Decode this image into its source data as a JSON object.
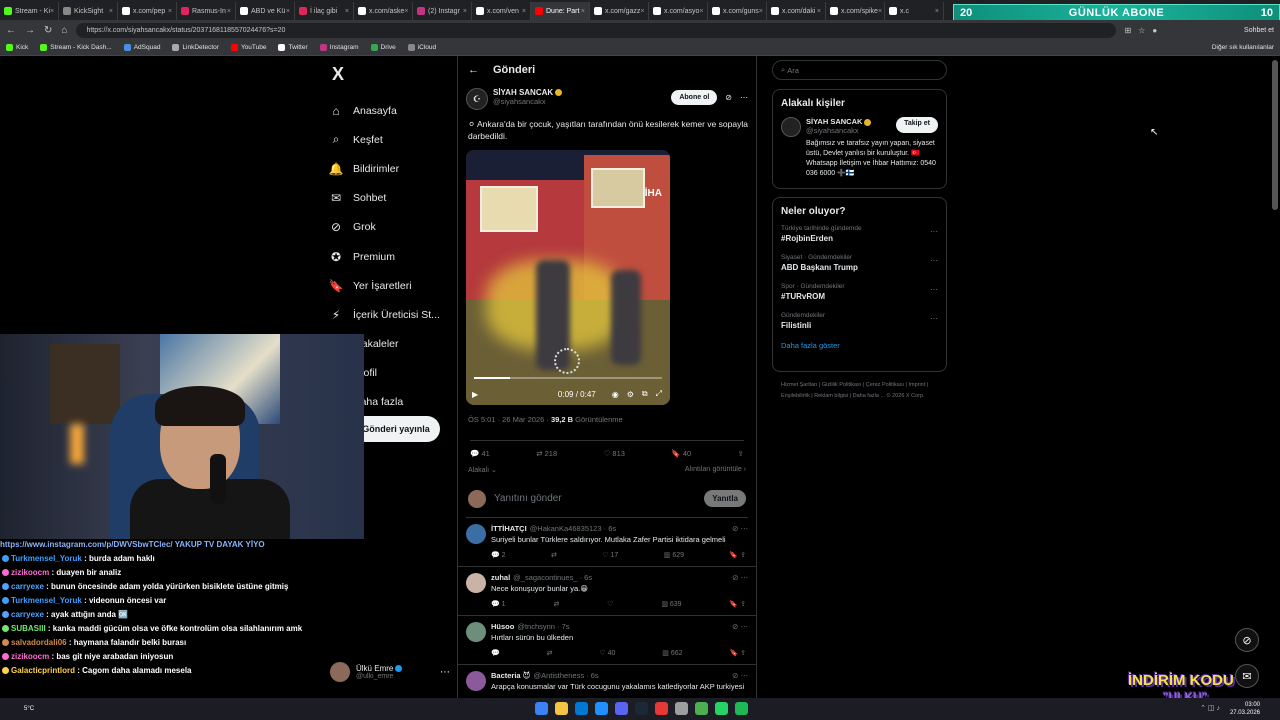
{
  "browser": {
    "tabs": [
      {
        "label": "Stream - Ki",
        "color": "#53fc18"
      },
      {
        "label": "KickSight",
        "color": "#888888"
      },
      {
        "label": "x.com/pep",
        "color": "#ffffff"
      },
      {
        "label": "Rasmus-In",
        "color": "#e0245e"
      },
      {
        "label": "ABD ve Kü",
        "color": "#ffffff"
      },
      {
        "label": "İ ilaç gibi",
        "color": "#e0245e"
      },
      {
        "label": "x.com/aske",
        "color": "#ffffff"
      },
      {
        "label": "(2) Instagr",
        "color": "#c13584"
      },
      {
        "label": "x.com/ven",
        "color": "#ffffff"
      },
      {
        "label": "Dune: Part",
        "color": "#ff0000"
      },
      {
        "label": "x.com/gazz",
        "color": "#ffffff"
      },
      {
        "label": "x.com/asyo",
        "color": "#ffffff"
      },
      {
        "label": "x.com/guns",
        "color": "#ffffff"
      },
      {
        "label": "x.com/daki",
        "color": "#ffffff"
      },
      {
        "label": "x.com/spike",
        "color": "#ffffff"
      },
      {
        "label": "x.c",
        "color": "#ffffff"
      }
    ],
    "url": "https://x.com/siyahsancakx/status/2037168118557024476?s=20",
    "chat_button": "Sohbet et",
    "bookmarks": [
      {
        "label": "Kick",
        "color": "#53fc18"
      },
      {
        "label": "Stream - Kick Dash...",
        "color": "#53fc18"
      },
      {
        "label": "AdSquad",
        "color": "#4a90e2"
      },
      {
        "label": "LinkDetector",
        "color": "#aaaaaa"
      },
      {
        "label": "YouTube",
        "color": "#ff0000"
      },
      {
        "label": "Twitter",
        "color": "#ffffff"
      },
      {
        "label": "Instagram",
        "color": "#c13584"
      },
      {
        "label": "Drive",
        "color": "#34a853"
      },
      {
        "label": "iCloud",
        "color": "#888888"
      }
    ],
    "other_bookmarks": "Diğer sık kullanılanlar"
  },
  "abone_banner": {
    "left": "20",
    "title": "GÜNLÜK ABONE",
    "right": "10"
  },
  "nav": {
    "logo": "X",
    "items": [
      {
        "label": "Anasayfa",
        "icon": "home-icon",
        "glyph": "⌂"
      },
      {
        "label": "Keşfet",
        "icon": "search-icon",
        "glyph": "⌕"
      },
      {
        "label": "Bildirimler",
        "icon": "bell-icon",
        "glyph": "🔔"
      },
      {
        "label": "Sohbet",
        "icon": "mail-icon",
        "glyph": "✉"
      },
      {
        "label": "Grok",
        "icon": "grok-icon",
        "glyph": "⊘"
      },
      {
        "label": "Premium",
        "icon": "premium-icon",
        "glyph": "✪"
      },
      {
        "label": "Yer İşaretleri",
        "icon": "bookmark-icon",
        "glyph": "🔖"
      },
      {
        "label": "İçerik Üreticisi St...",
        "icon": "creator-icon",
        "glyph": "⚡"
      },
      {
        "label": "Makaleler",
        "icon": "article-icon",
        "glyph": "▤"
      },
      {
        "label": "Profil",
        "icon": "profile-icon",
        "glyph": "◯"
      },
      {
        "label": "Daha fazla",
        "icon": "more-icon",
        "glyph": "⋯"
      }
    ],
    "post_button": "Gönderi yayınla",
    "profile": {
      "name": "Ülkü Emre",
      "handle": "@ulki_emre"
    }
  },
  "main": {
    "header": "Gönderi",
    "post": {
      "author": "SİYAH SANCAK",
      "handle": "@siyahsancakx",
      "subscribe": "Abone ol",
      "text": "⚪ Ankara'da bir çocuk, yaşıtları tarafından önü kesilerek kemer ve sopayla darbedildi.",
      "video": {
        "watermark": "İHA",
        "time": "0:09 / 0:47",
        "progress": 0.19
      },
      "time": "ÖS 5:01 · 26 Mar 2026 · ",
      "views": "39,2 B",
      "views_label": " Görüntülenme",
      "stats": {
        "replies": "41",
        "reposts": "218",
        "likes": "813",
        "bookmarks": "40"
      },
      "sort_label": "Alakalı",
      "quotes_label": "Alıntıları görüntüle"
    },
    "reply_box": {
      "placeholder": "Yanıtını gönder",
      "button": "Yanıtla"
    },
    "replies": [
      {
        "name": "İTTİHATÇI",
        "handle": "@HakanKa46835123 · 6s",
        "text": "Suriyeli bunlar Türklere saldırıyor. Mutlaka Zafer Partisi iktidara gelmeli",
        "r": "2",
        "rt": "",
        "l": "17",
        "v": "629",
        "color": "#3a6ea5"
      },
      {
        "name": "zuhal",
        "handle": "@_sagacontinues_ · 6s",
        "text": "Nece konuşuyor bunlar ya.😁",
        "r": "1",
        "rt": "",
        "l": "",
        "v": "639",
        "color": "#c9b2a6"
      },
      {
        "name": "Hüsoo",
        "handle": "@tnchsynn · 7s",
        "text": "Hırtları sürün bu ülkeden",
        "r": "",
        "rt": "",
        "l": "40",
        "v": "662",
        "color": "#6d8f7a"
      },
      {
        "name": "Bacteria 😈",
        "handle": "@Antistheness · 6s",
        "text": "Arapça konusmalar var Türk cocugunu yakalamıs katlediyorlar AKP turkiyesi",
        "r": "",
        "rt": "",
        "l": "",
        "v": "",
        "color": "#8a5a9a"
      }
    ]
  },
  "right": {
    "search_placeholder": "Ara",
    "related": {
      "title": "Alakalı kişiler",
      "name": "SİYAH SANCAK",
      "handle": "@siyahsancakx",
      "follow": "Takip et",
      "bio": "Bağımsız ve tarafsız yayın yapan, siyaset üstü, Devlet yanlısı bir kuruluştur. 🇹🇷 Whatsapp İletişim ve İhbar Hattımız: 0540 036 6000 ➕🇫🇮"
    },
    "trends": {
      "title": "Neler oluyor?",
      "items": [
        {
          "cat": "Türkiye tarihinde gündemde",
          "tag": "#RojbinErden"
        },
        {
          "cat": "Siyaset · Gündemdekiler",
          "tag": "ABD Başkanı Trump"
        },
        {
          "cat": "Spor · Gündemdekiler",
          "tag": "#TURvROM"
        },
        {
          "cat": "Gündemdekiler",
          "tag": "Filistinli"
        }
      ],
      "show_more": "Daha fazla göster"
    },
    "footer": "Hizmet Şartları | Gizlilik Politikası | Çerez Politikası | Imprint | Erişilebilirlik | Reklam bilgisi | Daha fazla ... © 2026 X Corp."
  },
  "chat": [
    {
      "user": "",
      "text": "https://www.instagram.com/p/DWVSbwTClec/ YAKUP TV DAYAK YİYO",
      "color": "#8ab4f8"
    },
    {
      "user": "Turkmensel_Yoruk",
      "text": " : burda adam haklı",
      "color": "#3aa0ff"
    },
    {
      "user": "zizikoocm",
      "text": " : duayen bir analiz",
      "color": "#ff6bd6"
    },
    {
      "user": "carryexe",
      "text": " : bunun öncesinde adam yolda yürürken bisiklete üstüne gitmiş",
      "color": "#4fa3ff"
    },
    {
      "user": "Turkmensel_Yoruk",
      "text": " : videonun öncesi var",
      "color": "#3aa0ff"
    },
    {
      "user": "carryexe",
      "text": " : ayak attığın anda 🆗",
      "color": "#4fa3ff"
    },
    {
      "user": "SUBASIII",
      "text": " : kanka maddi gücüm olsa ve öfke kontrolüm olsa silahlanırım amk",
      "color": "#6ee86e"
    },
    {
      "user": "salvadordali06",
      "text": " : haymana falandır belki burası",
      "color": "#d08a4e"
    },
    {
      "user": "zizikoocm",
      "text": " : bas git niye arabadan iniyosun",
      "color": "#ff6bd6"
    },
    {
      "user": "Galacticprintlord",
      "text": " : Cagom daha alamadı mesela",
      "color": "#ffd24a"
    }
  ],
  "overlay": {
    "indirim": "İNDİRİM KODU",
    "sub": "\"ULKU\""
  },
  "taskbar": {
    "temp": "5°C",
    "time": "03:00",
    "date": "27.03.2026"
  }
}
